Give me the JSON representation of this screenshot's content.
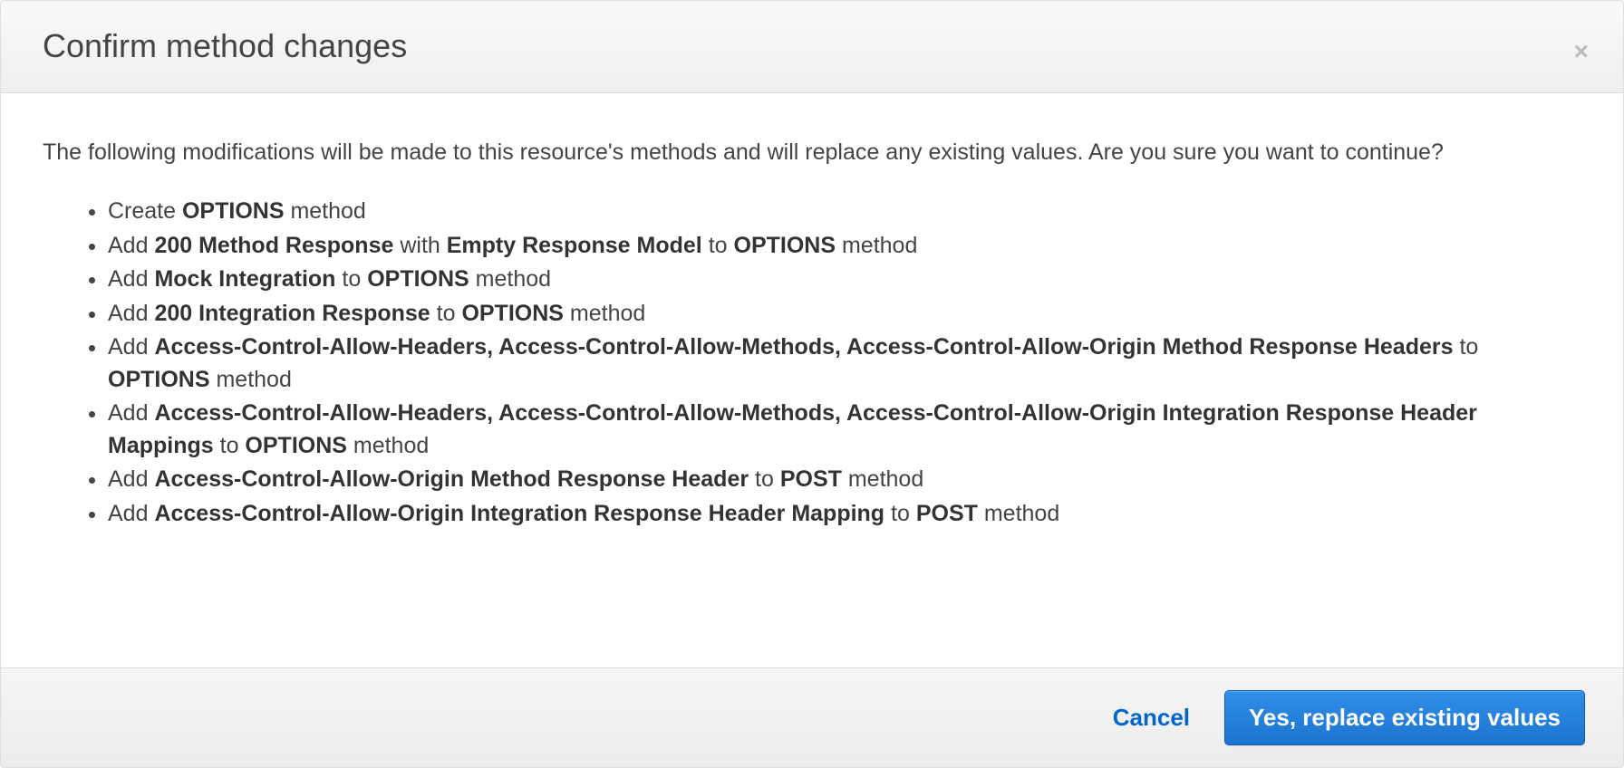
{
  "dialog": {
    "title": "Confirm method changes",
    "intro": "The following modifications will be made to this resource's methods and will replace any existing values. Are you sure you want to continue?",
    "items": [
      [
        {
          "t": "Create "
        },
        {
          "t": "OPTIONS",
          "b": true
        },
        {
          "t": " method"
        }
      ],
      [
        {
          "t": "Add "
        },
        {
          "t": "200 Method Response",
          "b": true
        },
        {
          "t": " with "
        },
        {
          "t": "Empty Response Model",
          "b": true
        },
        {
          "t": " to "
        },
        {
          "t": "OPTIONS",
          "b": true
        },
        {
          "t": " method"
        }
      ],
      [
        {
          "t": "Add "
        },
        {
          "t": "Mock Integration",
          "b": true
        },
        {
          "t": " to "
        },
        {
          "t": "OPTIONS",
          "b": true
        },
        {
          "t": " method"
        }
      ],
      [
        {
          "t": "Add "
        },
        {
          "t": "200 Integration Response",
          "b": true
        },
        {
          "t": " to "
        },
        {
          "t": "OPTIONS",
          "b": true
        },
        {
          "t": " method"
        }
      ],
      [
        {
          "t": "Add "
        },
        {
          "t": "Access-Control-Allow-Headers, Access-Control-Allow-Methods, Access-Control-Allow-Origin Method Response Headers",
          "b": true
        },
        {
          "t": " to "
        },
        {
          "t": "OPTIONS",
          "b": true
        },
        {
          "t": " method"
        }
      ],
      [
        {
          "t": "Add "
        },
        {
          "t": "Access-Control-Allow-Headers, Access-Control-Allow-Methods, Access-Control-Allow-Origin Integration Response Header Mappings",
          "b": true
        },
        {
          "t": " to "
        },
        {
          "t": "OPTIONS",
          "b": true
        },
        {
          "t": " method"
        }
      ],
      [
        {
          "t": "Add "
        },
        {
          "t": "Access-Control-Allow-Origin Method Response Header",
          "b": true
        },
        {
          "t": " to "
        },
        {
          "t": "POST",
          "b": true
        },
        {
          "t": " method"
        }
      ],
      [
        {
          "t": "Add "
        },
        {
          "t": "Access-Control-Allow-Origin Integration Response Header Mapping",
          "b": true
        },
        {
          "t": " to "
        },
        {
          "t": "POST",
          "b": true
        },
        {
          "t": " method"
        }
      ]
    ],
    "footer": {
      "cancel": "Cancel",
      "confirm": "Yes, replace existing values"
    }
  }
}
